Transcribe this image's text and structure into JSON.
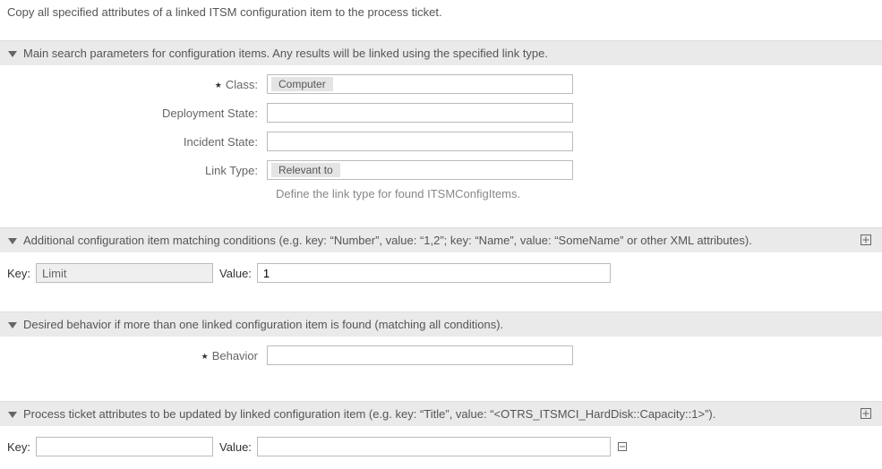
{
  "description": "Copy all specified attributes of a linked ITSM configuration item to the process ticket.",
  "sections": {
    "search": {
      "title": "Main search parameters for configuration items. Any results will be linked using the specified link type.",
      "class_label": "Class:",
      "class_value": "Computer",
      "deployment_label": "Deployment State:",
      "incident_label": "Incident State:",
      "linktype_label": "Link Type:",
      "linktype_value": "Relevant to",
      "linktype_help": "Define the link type for found ITSMConfigItems."
    },
    "additional": {
      "title": "Additional configuration item matching conditions (e.g. key: “Number”, value: “1,2”; key: “Name”, value: “SomeName” or other XML attributes).",
      "key_label": "Key:",
      "key_value": "Limit",
      "value_label": "Value:",
      "value_value": "1"
    },
    "behavior": {
      "title": "Desired behavior if more than one linked configuration item is found (matching all conditions).",
      "label": "Behavior"
    },
    "process": {
      "title": "Process ticket attributes to be updated by linked configuration item (e.g. key: “Title”, value: “<OTRS_ITSMCI_HardDisk::Capacity::1>”).",
      "key_label": "Key:",
      "key_value": "",
      "value_label": "Value:",
      "value_value": ""
    }
  }
}
